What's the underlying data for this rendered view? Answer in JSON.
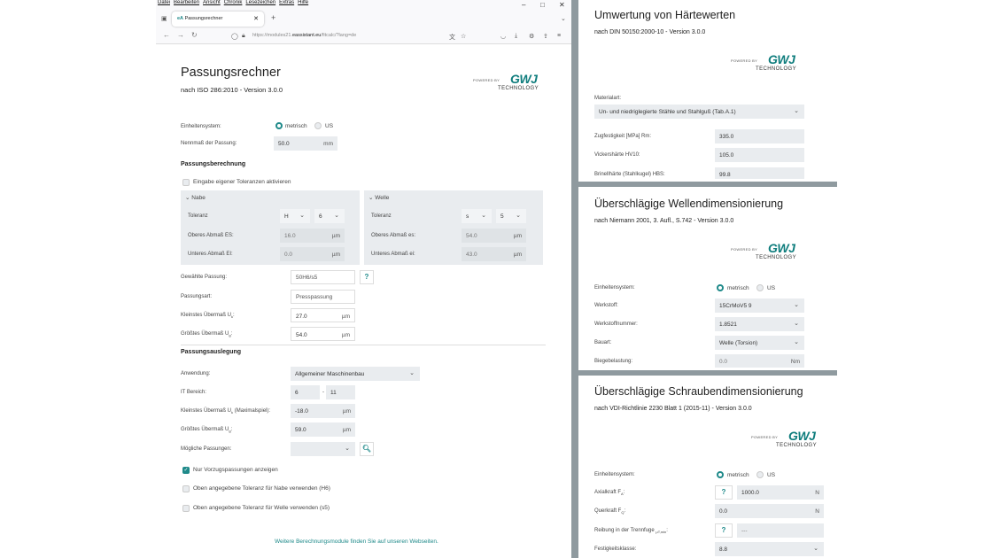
{
  "browser": {
    "menu": [
      "Datei",
      "Bearbeiten",
      "Ansicht",
      "Chronik",
      "Lesezeichen",
      "Extras",
      "Hilfe"
    ],
    "tab_favicon": "eA",
    "tab_title": "Passungsrechner",
    "url_prefix": "https://modules21.",
    "url_domain": "eassistant.eu",
    "url_suffix": "/fitcalc/?lang=de"
  },
  "left": {
    "title": "Passungsrechner",
    "subtitle": "nach ISO 286:2010 - Version 3.0.0",
    "logo": {
      "powered": "POWERED BY",
      "brand": "GWJ",
      "tech": "TECHNOLOGY"
    },
    "unit_system_label": "Einheitensystem:",
    "unit_metric": "metrisch",
    "unit_us": "US",
    "nominal_label": "Nennmaß der Passung:",
    "nominal_value": "50.0",
    "nominal_unit": "mm",
    "fit_calc_heading": "Passungsberechnung",
    "own_tol_label": "Eingabe eigener Toleranzen aktivieren",
    "hub": {
      "heading": "Nabe",
      "tol_label": "Toleranz",
      "tol_letter": "H",
      "tol_grade": "6",
      "upper_label": "Oberes Abmaß ES:",
      "upper_value": "16.0",
      "lower_label": "Unteres Abmaß EI:",
      "lower_value": "0.0",
      "unit": "µm"
    },
    "shaft": {
      "heading": "Welle",
      "tol_label": "Toleranz",
      "tol_letter": "s",
      "tol_grade": "5",
      "upper_label": "Oberes Abmaß es:",
      "upper_value": "54.0",
      "lower_label": "Unteres Abmaß ei:",
      "lower_value": "43.0",
      "unit": "µm"
    },
    "chosen_fit_label": "Gewählte Passung:",
    "chosen_fit_value": "50H6/s5",
    "help": "?",
    "fit_type_label": "Passungsart:",
    "fit_type_value": "Presspassung",
    "min_interf_label": "Kleinstes Übermaß U",
    "min_interf_sub": "k",
    "min_interf_value": "27.0",
    "max_interf_label": "Größtes Übermaß U",
    "max_interf_sub": "g",
    "max_interf_value": "54.0",
    "unit_um": "µm",
    "design_heading": "Passungsauslegung",
    "application_label": "Anwendung:",
    "application_value": "Allgemeiner Maschinenbau",
    "it_label": "IT Bereich:",
    "it_from": "6",
    "it_dash": "-",
    "it_to": "11",
    "min_interf2_label": "Kleinstes Übermaß U",
    "min_interf2_sub": "k",
    "min_interf2_suffix": " (Maximalspiel):",
    "min_interf2_value": "-18.0",
    "max_interf2_label": "Größtes Übermaß U",
    "max_interf2_sub": "g",
    "max_interf2_value": "59.0",
    "possible_label": "Mögliche Passungen:",
    "pref_only_label": "Nur Vorzugspassungen anzeigen",
    "use_hub_tol_label": "Oben angegebene Toleranz für Nabe verwenden (H6)",
    "use_shaft_tol_label": "Oben angegebene Toleranz für Welle verwenden (s5)",
    "footer_link": "Weitere Berechnungsmodule finden Sie auf unseren Webseiten."
  },
  "hardness": {
    "title": "Umwertung von Härtewerten",
    "subtitle": "nach DIN 50150:2000-10 - Version 3.0.0",
    "material_label": "Materialart:",
    "material_value": "Un- und niedriglegierte Stähle und Stahlguß (Tab.A.1)",
    "tensile_label": "Zugfestigkeit [MPa] Rm:",
    "tensile_value": "335.0",
    "vickers_label": "Vickershärte HV10:",
    "vickers_value": "105.0",
    "brinell_label": "Brinellhärte (Stahlkugel) HBS:",
    "brinell_value": "99.8"
  },
  "shaft_dim": {
    "title": "Überschlägige Wellendimensionierung",
    "subtitle": "nach Niemann 2001, 3. Aufl., S.742 - Version 3.0.0",
    "unit_label": "Einheitensystem:",
    "metric": "metrisch",
    "us": "US",
    "material_label": "Werkstoff:",
    "material_value": "15CrMoV5 9",
    "matno_label": "Werkstoffnummer:",
    "matno_value": "1.8521",
    "type_label": "Bauart:",
    "type_value": "Welle (Torsion)",
    "bending_label": "Biegebelastung:",
    "bending_value": "0.0",
    "bending_unit": "Nm"
  },
  "screw_dim": {
    "title": "Überschlägige Schraubendimensionierung",
    "subtitle": "nach VDI-Richtlinie 2230 Blatt 1 (2015-11) - Version 3.0.0",
    "unit_label": "Einheitensystem:",
    "metric": "metrisch",
    "us": "US",
    "axial_label": "Axialkraft F",
    "axial_sub": "A",
    "axial_value": "1000.0",
    "axial_unit": "N",
    "transverse_label": "Querkraft F",
    "transverse_sub": "Q",
    "transverse_value": "0.0",
    "transverse_unit": "N",
    "friction_label": "Reibung in der Trennfuge ",
    "friction_sub": "μT,min",
    "friction_value": "---",
    "strength_label": "Festigkeitsklasse:",
    "strength_value": "8.8"
  }
}
